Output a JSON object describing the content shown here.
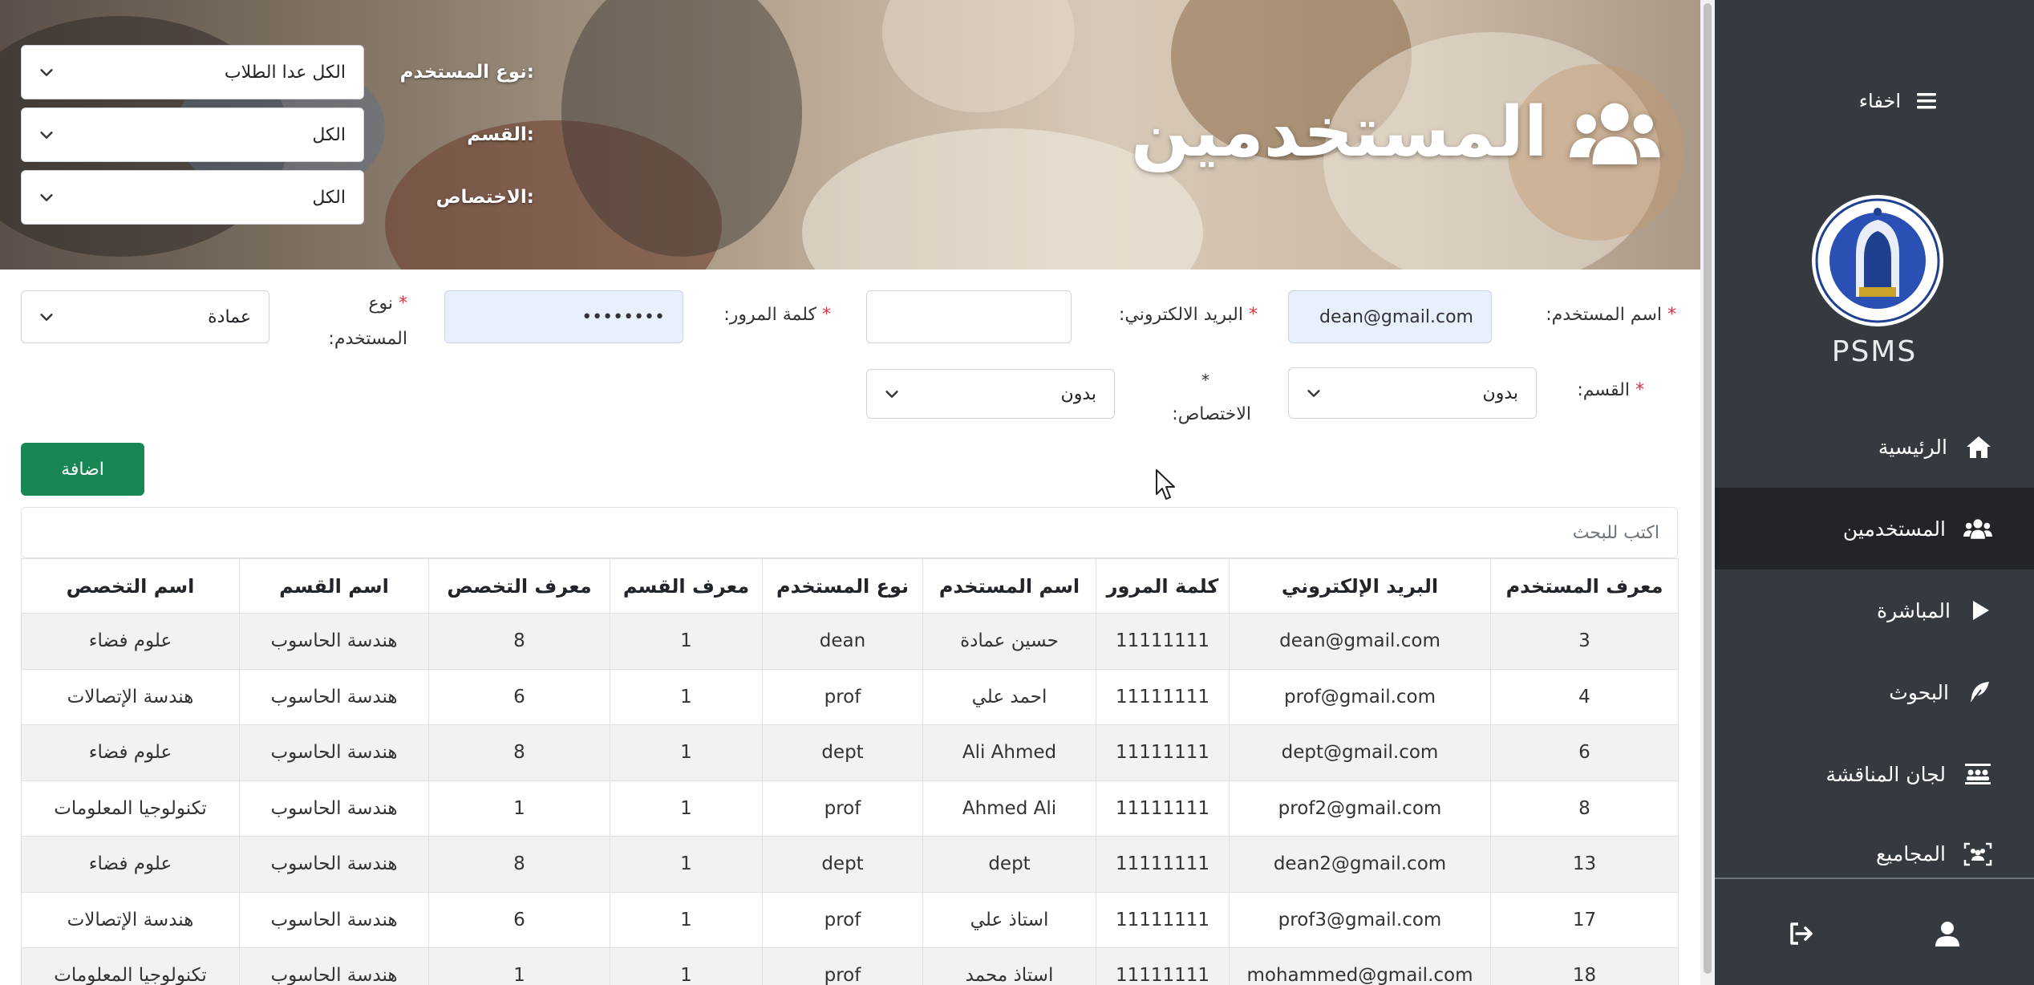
{
  "header": {
    "title": "المستخدمين"
  },
  "filters": {
    "user_type": {
      "label": "نوع المستخدم:",
      "value": "الكل عدا الطلاب"
    },
    "department": {
      "label": "القسم:",
      "value": "الكل"
    },
    "specialization": {
      "label": "الاختصاص:",
      "value": "الكل"
    }
  },
  "form": {
    "username": {
      "label": "اسم المستخدم:",
      "value": "dean@gmail.com"
    },
    "email": {
      "label": "البريد الالكتروني:",
      "value": ""
    },
    "password": {
      "label": "كلمة المرور:",
      "value": "••••••••"
    },
    "user_type": {
      "label_1": "نوع",
      "label_2": "المستخدم:",
      "value": "عمادة"
    },
    "department": {
      "label": "القسم:",
      "value": "بدون"
    },
    "specialization": {
      "label": "الاختصاص:",
      "value": "بدون"
    },
    "required_mark": "*",
    "add_button": "اضافة"
  },
  "search": {
    "placeholder": "اكتب للبحث"
  },
  "table": {
    "headers": [
      "معرف المستخدم",
      "البريد الإلكتروني",
      "كلمة المرور",
      "اسم المستخدم",
      "نوع المستخدم",
      "معرف القسم",
      "معرف التخصص",
      "اسم القسم",
      "اسم التخصص"
    ],
    "rows": [
      [
        "3",
        "dean@gmail.com",
        "11111111",
        "حسين عمادة",
        "dean",
        "1",
        "8",
        "هندسة الحاسوب",
        "علوم فضاء"
      ],
      [
        "4",
        "prof@gmail.com",
        "11111111",
        "احمد علي",
        "prof",
        "1",
        "6",
        "هندسة الحاسوب",
        "هندسة الإتصالات"
      ],
      [
        "6",
        "dept@gmail.com",
        "11111111",
        "Ali Ahmed",
        "dept",
        "1",
        "8",
        "هندسة الحاسوب",
        "علوم فضاء"
      ],
      [
        "8",
        "prof2@gmail.com",
        "11111111",
        "Ahmed Ali",
        "prof",
        "1",
        "1",
        "هندسة الحاسوب",
        "تكنولوجيا المعلومات"
      ],
      [
        "13",
        "dean2@gmail.com",
        "11111111",
        "dept",
        "dept",
        "1",
        "8",
        "هندسة الحاسوب",
        "علوم فضاء"
      ],
      [
        "17",
        "prof3@gmail.com",
        "11111111",
        "استاذ علي",
        "prof",
        "1",
        "6",
        "هندسة الحاسوب",
        "هندسة الإتصالات"
      ],
      [
        "18",
        "mohammed@gmail.com",
        "11111111",
        "استاذ محمد",
        "prof",
        "1",
        "1",
        "هندسة الحاسوب",
        "تكنولوجيا المعلومات"
      ]
    ]
  },
  "sidebar": {
    "toggle_label": "اخفاء",
    "brand": "PSMS",
    "items": [
      {
        "label": "الرئيسية",
        "icon": "home-icon"
      },
      {
        "label": "المستخدمين",
        "icon": "users-icon"
      },
      {
        "label": "المباشرة",
        "icon": "play-icon"
      },
      {
        "label": "البحوث",
        "icon": "feather-icon"
      },
      {
        "label": "لجان المناقشة",
        "icon": "committee-icon"
      },
      {
        "label": "المجاميع",
        "icon": "groups-icon"
      }
    ]
  },
  "colors": {
    "sidebar": "#343a40",
    "sidebar_active": "#212529",
    "accent": "#198754",
    "required": "#dc3545"
  }
}
